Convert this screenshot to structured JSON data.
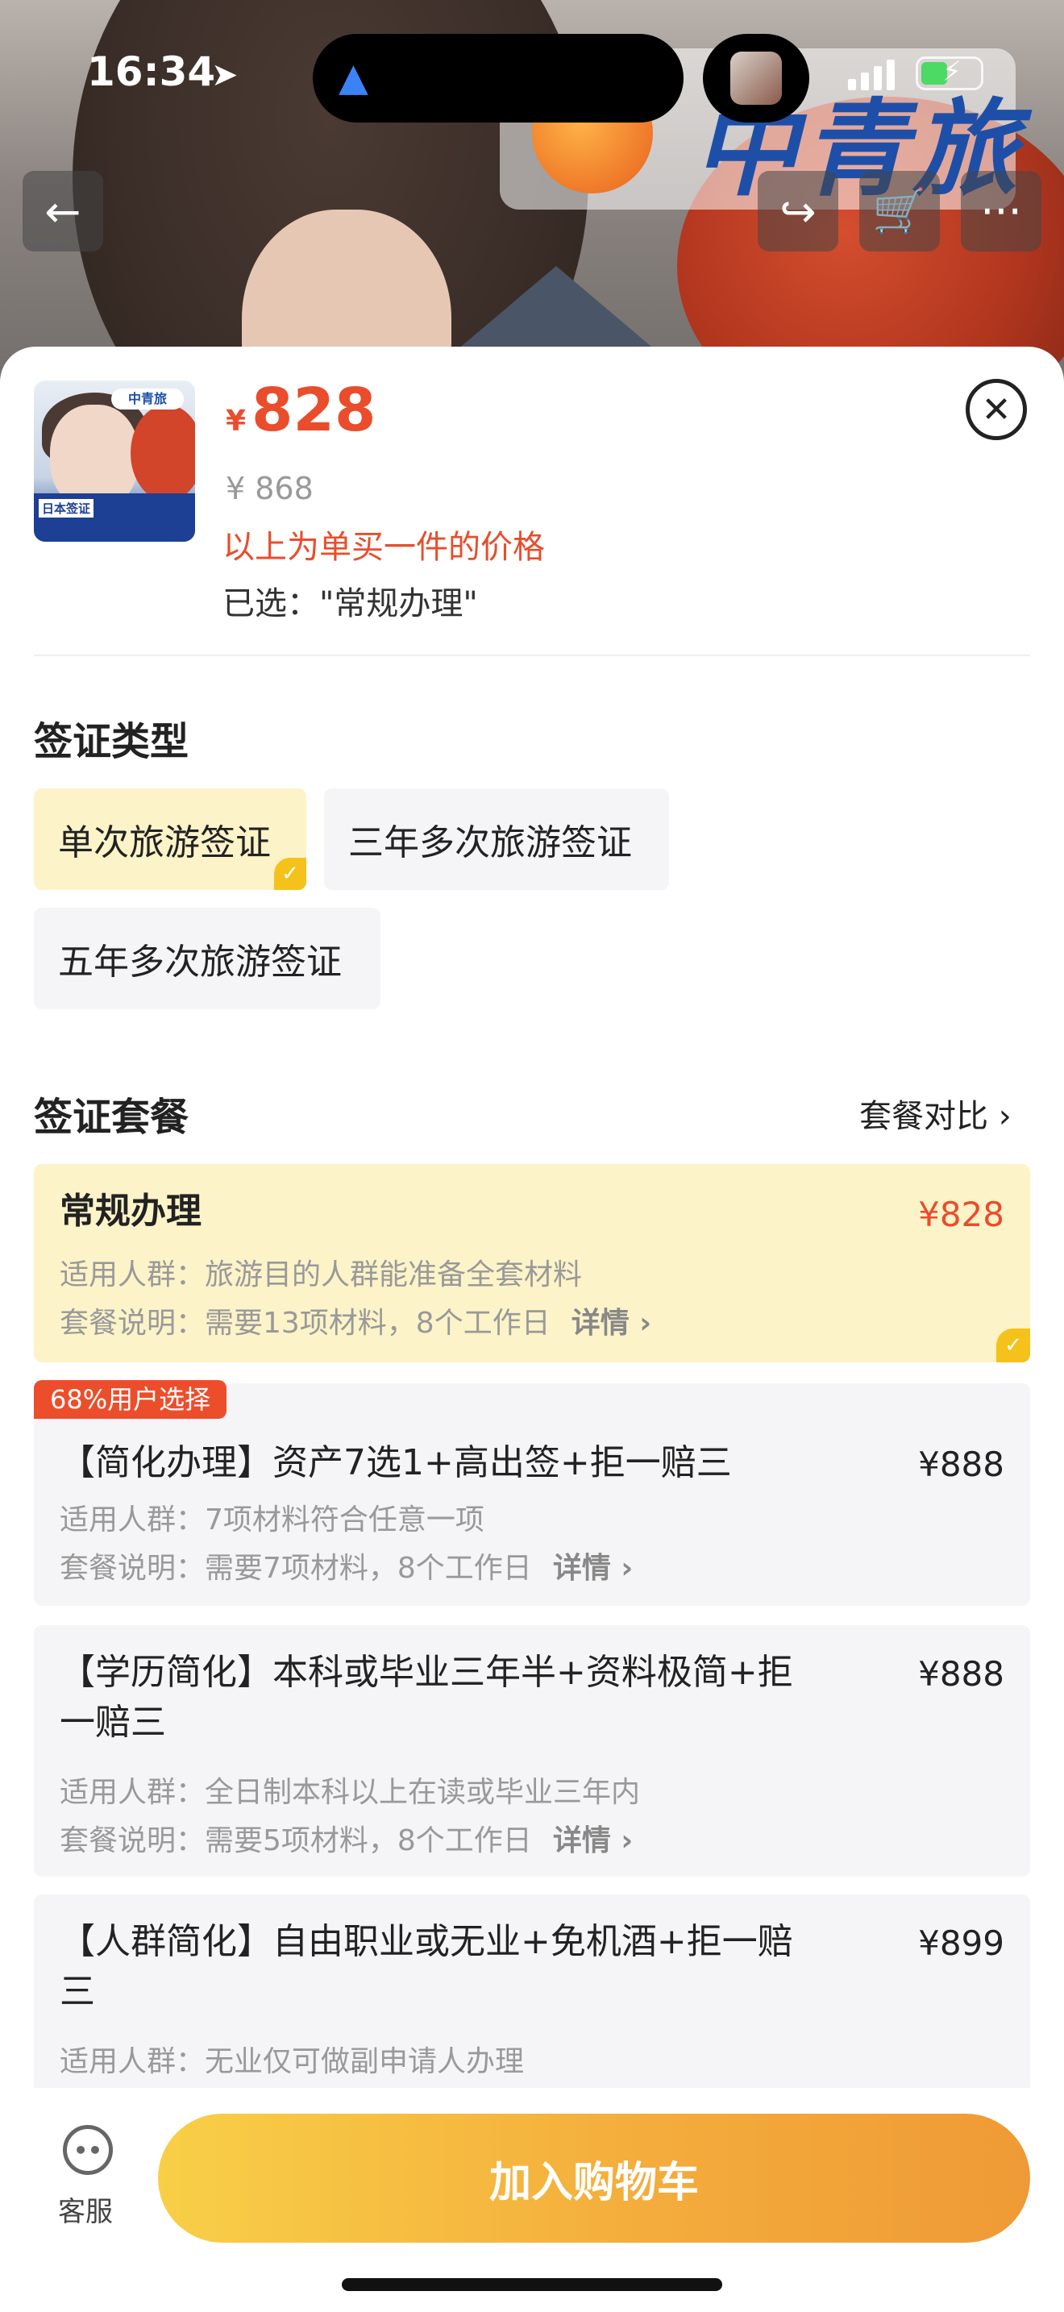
{
  "status_bar": {
    "time": "16:34"
  },
  "hero": {
    "logo_text": "中青旅"
  },
  "product": {
    "thumb_badge": "中青旅",
    "thumb_label": "日本签证",
    "price_symbol": "¥",
    "price": "828",
    "original_price": "¥ 868",
    "price_note": "以上为单买一件的价格",
    "selected": "已选：\"常规办理\""
  },
  "visa_type": {
    "title": "签证类型",
    "options": [
      {
        "label": "单次旅游签证",
        "selected": true
      },
      {
        "label": "三年多次旅游签证",
        "selected": false
      },
      {
        "label": "五年多次旅游签证",
        "selected": false
      }
    ]
  },
  "packages": {
    "title": "签证套餐",
    "compare_label": "套餐对比 ›",
    "popular_badge": "68%用户选择",
    "items": [
      {
        "name": "常规办理",
        "price": "¥828",
        "audience": "适用人群：旅游目的人群能准备全套材料",
        "desc": "套餐说明：需要13项材料，8个工作日",
        "detail": "详情 ›",
        "selected": true
      },
      {
        "name": "【简化办理】资产7选1+高出签+拒一赔三",
        "price": "¥888",
        "audience": "适用人群：7项材料符合任意一项",
        "desc": "套餐说明：需要7项材料，8个工作日",
        "detail": "详情 ›",
        "selected": false
      },
      {
        "name": "【学历简化】本科或毕业三年半+资料极简+拒一赔三",
        "price": "¥888",
        "audience": "适用人群：全日制本科以上在读或毕业三年内",
        "desc": "套餐说明：需要5项材料，8个工作日",
        "detail": "详情 ›",
        "selected": false
      },
      {
        "name": "【人群简化】自由职业或无业+免机酒+拒一赔三",
        "price": "¥899",
        "audience": "适用人群：无业仅可做副申请人办理",
        "selected": false
      }
    ]
  },
  "bottom": {
    "customer_service": "客服",
    "add_to_cart": "加入购物车"
  }
}
